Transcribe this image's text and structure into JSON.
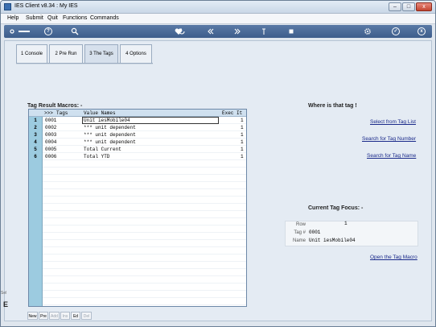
{
  "window": {
    "title": "IES Client v8.34 : My IES"
  },
  "menu": [
    "Help",
    "Submit",
    "Quit",
    "Functions",
    "Commands"
  ],
  "toolbar": {
    "icons": [
      "key-icon",
      "help-icon",
      "search-icon",
      "heart-icon",
      "refresh-icon",
      "rewind-icon",
      "fast-forward-icon",
      "upload-icon",
      "stop-icon",
      "settings-icon",
      "check-icon",
      "close-icon"
    ],
    "help_glyph": "?",
    "check_glyph": "✓",
    "close_glyph": "x"
  },
  "tabs": [
    {
      "label": "1 Console"
    },
    {
      "label": "2 Pre Run"
    },
    {
      "label": "3 The Tags"
    },
    {
      "label": "4 Options"
    }
  ],
  "grid": {
    "title": "Tag Result Macros: -",
    "columns": {
      "arrow": ">>>",
      "tags": "Tags",
      "value_names": "Value Names",
      "exec_it": "Exec It"
    },
    "rows": [
      {
        "num": "1",
        "tag": "0001",
        "value": "Unit iesMobile04",
        "exec": "1"
      },
      {
        "num": "2",
        "tag": "0002",
        "value": "*** unit dependent",
        "exec": "1"
      },
      {
        "num": "3",
        "tag": "0003",
        "value": "*** unit dependent",
        "exec": "1"
      },
      {
        "num": "4",
        "tag": "0004",
        "value": "*** unit dependent",
        "exec": "1"
      },
      {
        "num": "5",
        "tag": "0005",
        "value": "Total Current",
        "exec": "1"
      },
      {
        "num": "6",
        "tag": "0006",
        "value": "Total YTD",
        "exec": "1"
      }
    ]
  },
  "nav_buttons": [
    {
      "label": "New",
      "enabled": true
    },
    {
      "label": "Pre",
      "enabled": true
    },
    {
      "label": "Add",
      "enabled": false
    },
    {
      "label": "Ins",
      "enabled": false
    },
    {
      "label": "Ed",
      "enabled": true
    },
    {
      "label": "Del",
      "enabled": false
    }
  ],
  "where_panel": {
    "title": "Where is that tag !",
    "links": [
      "Select from Tag List",
      "Search for Tag Number",
      "Search for Tag Name"
    ]
  },
  "focus_panel": {
    "title": "Current Tag Focus: -",
    "row_label": "Row",
    "row_value": "1",
    "tag_label": "Tag #",
    "tag_value": "0001",
    "name_label": "Name",
    "name_value": "Unit iesMobile04",
    "open_link": "Open the Tag Macro"
  },
  "side_stub": {
    "label": "Sel",
    "letter": "E"
  }
}
